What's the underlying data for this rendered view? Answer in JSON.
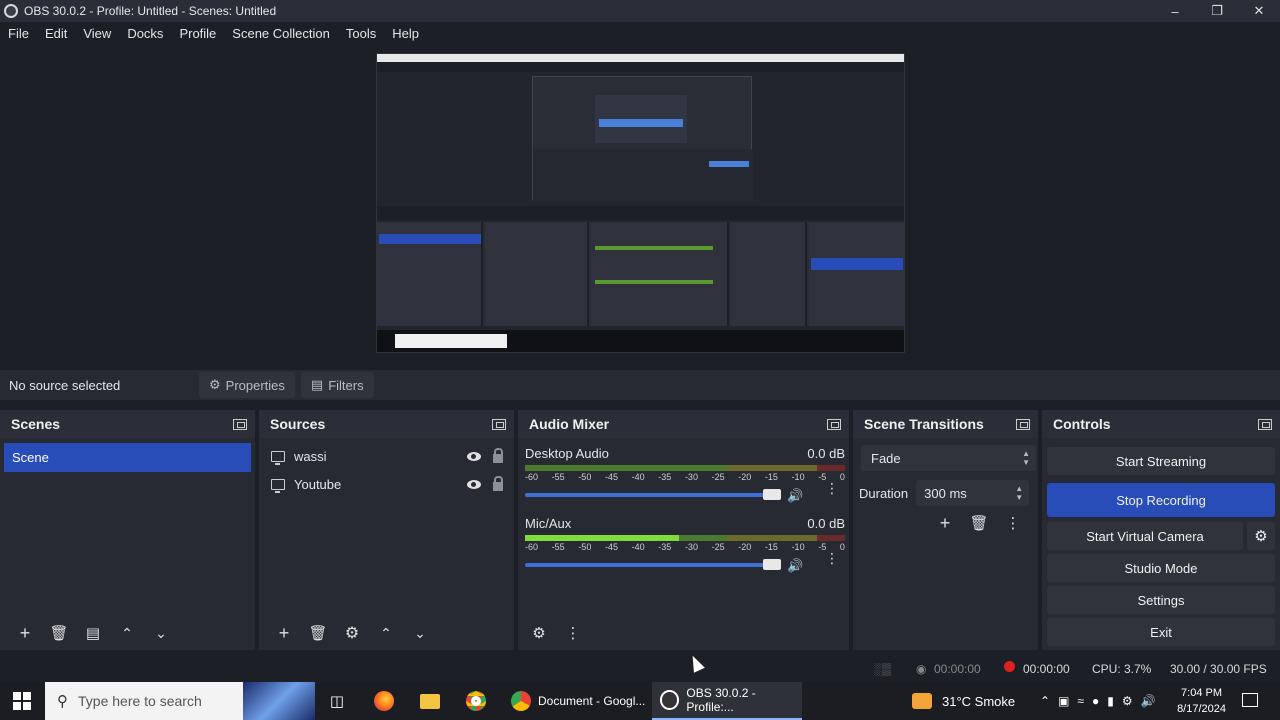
{
  "window": {
    "title": "OBS 30.0.2 - Profile: Untitled - Scenes: Untitled"
  },
  "menu": [
    "File",
    "Edit",
    "View",
    "Docks",
    "Profile",
    "Scene Collection",
    "Tools",
    "Help"
  ],
  "source_bar": {
    "status": "No source selected",
    "properties": "Properties",
    "filters": "Filters"
  },
  "scenes": {
    "title": "Scenes",
    "items": [
      "Scene"
    ]
  },
  "sources": {
    "title": "Sources",
    "items": [
      "wassi",
      "Youtube"
    ]
  },
  "audio": {
    "title": "Audio Mixer",
    "scale": [
      "-60",
      "-55",
      "-50",
      "-45",
      "-40",
      "-35",
      "-30",
      "-25",
      "-20",
      "-15",
      "-10",
      "-5",
      "0"
    ],
    "channels": [
      {
        "name": "Desktop Audio",
        "db": "0.0 dB",
        "level": 0.0
      },
      {
        "name": "Mic/Aux",
        "db": "0.0 dB",
        "level": 0.48
      }
    ]
  },
  "transitions": {
    "title": "Scene Transitions",
    "selected": "Fade",
    "duration_label": "Duration",
    "duration_value": "300 ms"
  },
  "controls": {
    "title": "Controls",
    "start_streaming": "Start Streaming",
    "stop_recording": "Stop Recording",
    "start_virtual_camera": "Start Virtual Camera",
    "studio_mode": "Studio Mode",
    "settings": "Settings",
    "exit": "Exit"
  },
  "status": {
    "stream_time": "00:00:00",
    "rec_time": "00:00:00",
    "cpu": "CPU: 3.7%",
    "fps": "30.00 / 30.00 FPS"
  },
  "taskbar": {
    "search_placeholder": "Type here to search",
    "doc_label": "Document - Googl...",
    "obs_label": "OBS 30.0.2 - Profile:...",
    "weather": "31°C  Smoke",
    "time": "7:04 PM",
    "date": "8/17/2024"
  },
  "colors": {
    "accent": "#284cb8",
    "record": "#e02020",
    "meter_green": "#7fdc3a"
  }
}
